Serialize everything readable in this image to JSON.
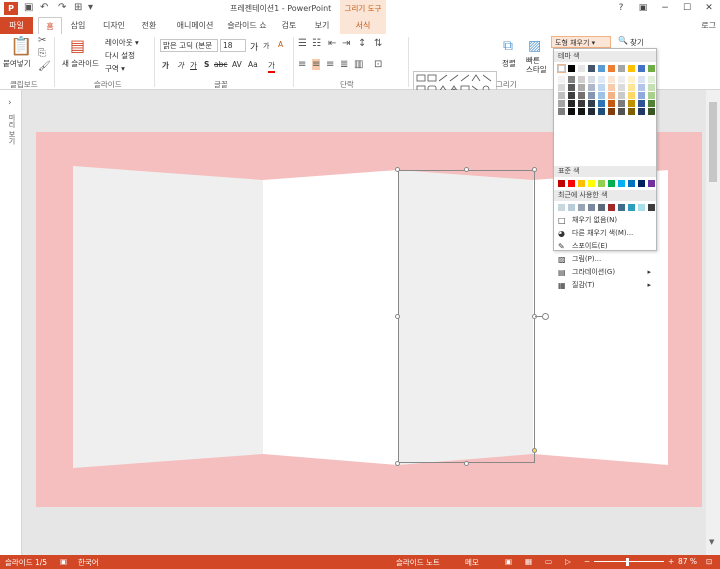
{
  "app": {
    "logo": "P",
    "title": "프레젠테이션1 - PowerPoint",
    "context_group": "그리기 도구",
    "login": "로그"
  },
  "window_controls": {
    "help": "?",
    "restore": "▣",
    "minimize": "−",
    "maximize": "☐",
    "close": "✕"
  },
  "quick_access": {
    "save_icon": "save-icon",
    "undo_icon": "undo-icon",
    "redo_icon": "redo-icon"
  },
  "tabs": [
    "파일",
    "홈",
    "삽입",
    "디자인",
    "전환",
    "애니메이션",
    "슬라이드 쇼",
    "검토",
    "보기",
    "서식"
  ],
  "ribbon": {
    "clipboard": {
      "paste": "붙여넣기",
      "label": "클립보드"
    },
    "slides": {
      "new_slide": "새 슬라이드",
      "layout": "레이아웃 ▾",
      "reset": "다시 설정",
      "section": "구역 ▾",
      "label": "슬라이드"
    },
    "font": {
      "name": "맑은 고딕 (본문",
      "size": "18",
      "label": "글꼴",
      "bold": "가",
      "italic": "가",
      "underline": "가",
      "strike": "abc",
      "shadow": "S",
      "spacing": "AV",
      "case": "Aa",
      "color": "가",
      "grow": "가",
      "shrink": "가",
      "clear": "A"
    },
    "paragraph": {
      "label": "단락"
    },
    "drawing": {
      "arrange": "정렬",
      "quick_styles": "빠른\n스타일",
      "label": "그리기"
    },
    "shape_fill": "도형 채우기 ▾",
    "find": "찾기"
  },
  "left_pane": {
    "label": "미리 보기"
  },
  "dropdown": {
    "theme_header": "테마 색",
    "theme_top": [
      "#ffffff",
      "#000000",
      "#e7e6e6",
      "#44546a",
      "#5b9bd5",
      "#ed7d31",
      "#a5a5a5",
      "#ffc000",
      "#4472c4",
      "#70ad47"
    ],
    "theme_shades": [
      [
        "#f2f2f2",
        "#7f7f7f",
        "#d0cece",
        "#d6dce4",
        "#deebf6",
        "#fbe5d5",
        "#ededed",
        "#fff2cc",
        "#dae3f3",
        "#e2efd9"
      ],
      [
        "#d8d8d8",
        "#595959",
        "#aeabab",
        "#adb9ca",
        "#bdd7ee",
        "#f7cbac",
        "#dbdbdb",
        "#fee599",
        "#b4c6e7",
        "#c5e0b3"
      ],
      [
        "#bfbfbf",
        "#3f3f3f",
        "#757070",
        "#8496b0",
        "#9cc3e5",
        "#f4b183",
        "#c9c9c9",
        "#ffd965",
        "#8eaadb",
        "#a8d08d"
      ],
      [
        "#a5a5a5",
        "#262626",
        "#3a3838",
        "#323f4f",
        "#2e75b5",
        "#c55a11",
        "#7b7b7b",
        "#bf9000",
        "#2f5496",
        "#538135"
      ],
      [
        "#7f7f7f",
        "#0c0c0c",
        "#171616",
        "#222a35",
        "#1e4e79",
        "#833c0b",
        "#525252",
        "#7f6000",
        "#1f3864",
        "#375623"
      ]
    ],
    "standard_header": "표준 색",
    "standard": [
      "#c00000",
      "#ff0000",
      "#ffc000",
      "#ffff00",
      "#92d050",
      "#00b050",
      "#00b0f0",
      "#0070c0",
      "#002060",
      "#7030a0"
    ],
    "recent_header": "최근에 사용한 색",
    "recent": [
      "#c9d8df",
      "#b8cdd9",
      "#97a4b3",
      "#7a8a9a",
      "#5b6b79",
      "#9e2a2a",
      "#3f6e8c",
      "#2e9ebf",
      "#a9dfe8",
      "#3d3d3d"
    ],
    "items": [
      {
        "label": "채우기 없음(N)",
        "icon": "none-icon"
      },
      {
        "label": "다른 채우기 색(M)...",
        "icon": "palette-icon"
      },
      {
        "label": "스포이트(E)",
        "icon": "eyedropper-icon"
      },
      {
        "label": "그림(P)...",
        "icon": "picture-icon"
      },
      {
        "label": "그라데이션(G)",
        "icon": "gradient-icon",
        "submenu": true
      },
      {
        "label": "질감(T)",
        "icon": "texture-icon",
        "submenu": true
      }
    ]
  },
  "status": {
    "slide": "슬라이드 1/5",
    "language": "한국어",
    "notes": "슬라이드 노트",
    "comments": "메모",
    "zoom": "87 %"
  }
}
